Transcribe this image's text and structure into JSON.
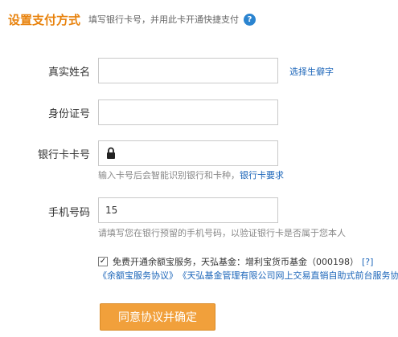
{
  "header": {
    "title": "设置支付方式",
    "subtitle": "填写银行卡号，并用此卡开通快捷支付",
    "help_icon": "?"
  },
  "form": {
    "name": {
      "label": "真实姓名",
      "value": "",
      "link": "选择生僻字"
    },
    "id_number": {
      "label": "身份证号",
      "value": ""
    },
    "bank_card": {
      "label": "银行卡卡号",
      "value": "",
      "hint": "输入卡号后会智能识别银行和卡种，",
      "hint_link": "银行卡要求"
    },
    "phone": {
      "label": "手机号码",
      "value": "15",
      "hint": "请填写您在银行预留的手机号码，以验证银行卡是否属于您本人"
    }
  },
  "agreement": {
    "checked": true,
    "check_mark": "✓",
    "text": "免费开通余额宝服务，天弘基金：增利宝货币基金（000198）",
    "more": "[?]",
    "protocols": [
      "《余额宝服务协议》",
      "《天弘基金管理有限公司网上交易直销自助式前台服务协议》"
    ]
  },
  "submit_label": "同意协议并确定",
  "colors": {
    "accent": "#e8820c",
    "link": "#1b65b9",
    "button": "#f1a03b"
  }
}
